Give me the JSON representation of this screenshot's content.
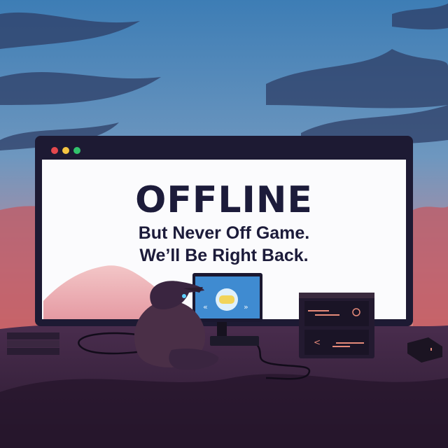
{
  "screen": {
    "title": "OFFLINE",
    "line1": "But Never Off Game.",
    "line2": "We’ll Be Right Back."
  },
  "window_controls": [
    "close",
    "minimize",
    "maximize"
  ],
  "colors": {
    "sky_top": "#3f7fb6",
    "sky_bottom": "#e07a6a",
    "ground": "#3a2440",
    "frame": "#1d1a33",
    "text": "#1c1b3a",
    "btn_close": "#e5484d",
    "btn_min": "#f5c542",
    "btn_max": "#32c36c"
  },
  "icons": {
    "small_monitor_emblem": "gamepad-emblem-icon",
    "left_arrow": "rewind-icon",
    "right_arrow": "fast-forward-icon"
  }
}
